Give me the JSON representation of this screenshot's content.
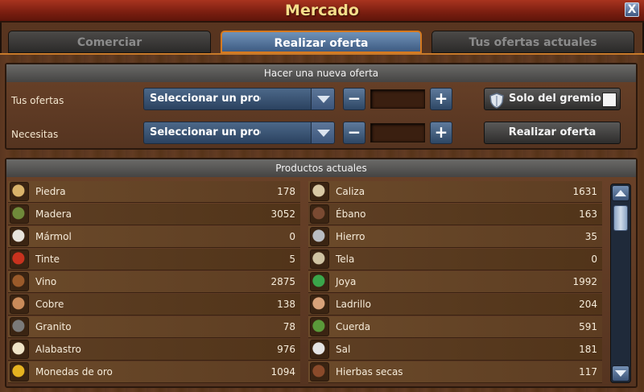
{
  "window": {
    "title": "Mercado",
    "close_label": "X"
  },
  "tabs": [
    {
      "label": "Comerciar",
      "active": false
    },
    {
      "label": "Realizar oferta",
      "active": true
    },
    {
      "label": "Tus ofertas actuales",
      "active": false
    }
  ],
  "new_offer": {
    "heading": "Hacer una nueva oferta",
    "offers_label": "Tus ofertas",
    "needs_label": "Necesitas",
    "offers_select": "Seleccionar un producto",
    "needs_select": "Seleccionar un producto",
    "minus_label": "−",
    "plus_label": "+",
    "guild_only_label": "Solo del gremio",
    "submit_label": "Realizar oferta"
  },
  "products": {
    "heading": "Productos actuales",
    "left": [
      {
        "name": "Piedra",
        "value": "178",
        "icon": "stone-icon",
        "color": "#d9b36a"
      },
      {
        "name": "Madera",
        "value": "3052",
        "icon": "wood-icon",
        "color": "#6f8a3a"
      },
      {
        "name": "Mármol",
        "value": "0",
        "icon": "marble-icon",
        "color": "#e8e4dc"
      },
      {
        "name": "Tinte",
        "value": "5",
        "icon": "dye-icon",
        "color": "#c8321e"
      },
      {
        "name": "Vino",
        "value": "2875",
        "icon": "wine-icon",
        "color": "#9a5a2a"
      },
      {
        "name": "Cobre",
        "value": "138",
        "icon": "copper-icon",
        "color": "#c98b5a"
      },
      {
        "name": "Granito",
        "value": "78",
        "icon": "granite-icon",
        "color": "#7a7a7a"
      },
      {
        "name": "Alabastro",
        "value": "976",
        "icon": "alabaster-icon",
        "color": "#efe4c8"
      },
      {
        "name": "Monedas de oro",
        "value": "1094",
        "icon": "gold-coins-icon",
        "color": "#e6b320"
      }
    ],
    "right": [
      {
        "name": "Caliza",
        "value": "1631",
        "icon": "limestone-icon",
        "color": "#d8c8a4"
      },
      {
        "name": "Ébano",
        "value": "163",
        "icon": "ebony-icon",
        "color": "#7a4a32"
      },
      {
        "name": "Hierro",
        "value": "35",
        "icon": "iron-icon",
        "color": "#b8bcc2"
      },
      {
        "name": "Tela",
        "value": "0",
        "icon": "cloth-icon",
        "color": "#cfc3a2"
      },
      {
        "name": "Joya",
        "value": "1992",
        "icon": "jewel-icon",
        "color": "#3aa64a"
      },
      {
        "name": "Ladrillo",
        "value": "204",
        "icon": "brick-icon",
        "color": "#d8a27a"
      },
      {
        "name": "Cuerda",
        "value": "591",
        "icon": "rope-icon",
        "color": "#5a9a3a"
      },
      {
        "name": "Sal",
        "value": "181",
        "icon": "salt-icon",
        "color": "#e4e4e4"
      },
      {
        "name": "Hierbas secas",
        "value": "117",
        "icon": "dried-herbs-icon",
        "color": "#8a4a2a"
      }
    ]
  }
}
